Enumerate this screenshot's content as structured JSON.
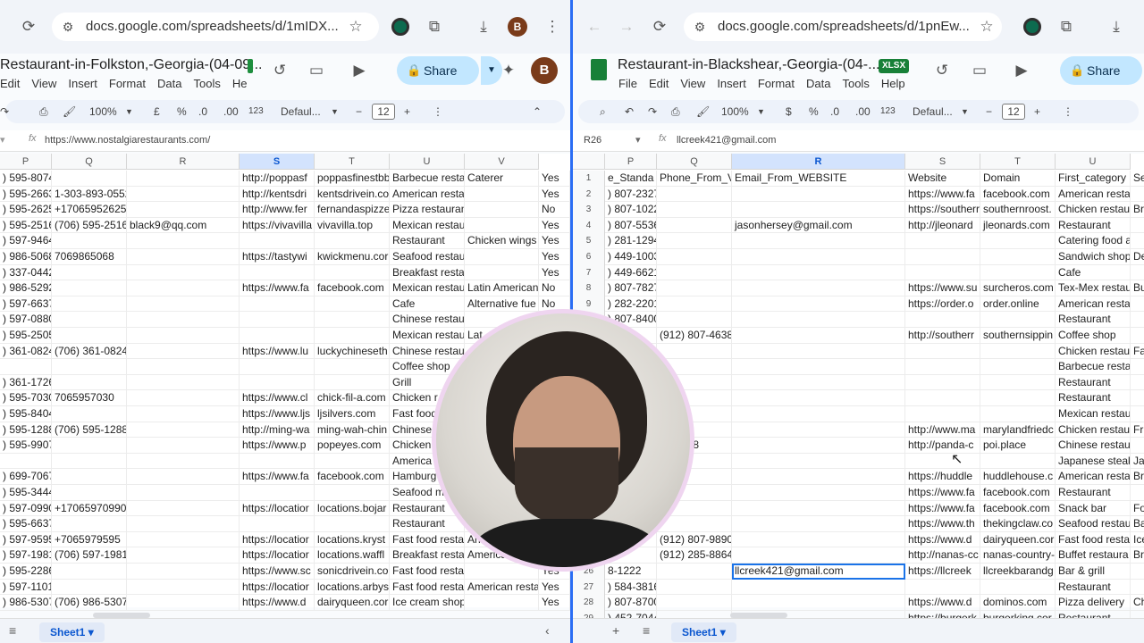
{
  "left": {
    "url": "docs.google.com/spreadsheets/d/1mIDX...",
    "doc_title": "Restaurant-in-Folkston,-Georgia-(04-09...",
    "menu": [
      "Edit",
      "View",
      "Insert",
      "Format",
      "Data",
      "Tools",
      "He"
    ],
    "avatar": "B",
    "share": "Share",
    "zoom": "100%",
    "currency": "£",
    "percent": "%",
    "dec_dec": ".0",
    "dec_inc": ".00",
    "num_fmt": "123",
    "font": "Defaul...",
    "font_size": "12",
    "formula": "https://www.nostalgiarestaurants.com/",
    "columns": [
      "P",
      "Q",
      "R",
      "S",
      "T",
      "U",
      "V"
    ],
    "sheet_tab": "Sheet1",
    "rows": [
      [
        ") 595-8074",
        "",
        "",
        "http://poppasf",
        "poppasfinestbb",
        "Barbecue resta",
        "Caterer",
        "Yes"
      ],
      [
        ") 595-2663",
        "1-303-893-0552",
        "",
        "http://kentsdri",
        "kentsdrivein.co",
        "American resta",
        "",
        "Yes"
      ],
      [
        ") 595-2625",
        "+17065952625 | (706) 595-2625",
        "",
        "http://www.fer",
        "fernandaspizze",
        "Pizza restauran",
        "",
        "No"
      ],
      [
        ") 595-2516",
        "(706) 595-2516",
        "black9@qq.com",
        "https://vivavilla",
        "vivavilla.top",
        "Mexican restau",
        "",
        "Yes"
      ],
      [
        ") 597-9464",
        "",
        "",
        "",
        "",
        "Restaurant",
        "Chicken wings",
        "Yes"
      ],
      [
        ") 986-5068",
        "7069865068",
        "",
        "https://tastywi",
        "kwickmenu.cor",
        "Seafood restau",
        "",
        "Yes"
      ],
      [
        ") 337-0442",
        "",
        "",
        "",
        "",
        "Breakfast resta",
        "",
        "Yes"
      ],
      [
        ") 986-5292",
        "",
        "",
        "https://www.fa",
        "facebook.com",
        "Mexican restau",
        "Latin American",
        "No"
      ],
      [
        ") 597-6637",
        "",
        "",
        "",
        "",
        "Cafe",
        "Alternative fue",
        "No"
      ],
      [
        ") 597-0880",
        "",
        "",
        "",
        "",
        "Chinese restau",
        "",
        ""
      ],
      [
        ") 595-2505",
        "",
        "",
        "",
        "",
        "Mexican restau",
        "Lat",
        ""
      ],
      [
        ") 361-0824",
        "(706) 361-0824",
        "",
        "https://www.lu",
        "luckychineseth",
        "Chinese restau",
        "",
        ""
      ],
      [
        "",
        "",
        "",
        "",
        "",
        "Coffee shop",
        "",
        ""
      ],
      [
        ") 361-1726",
        "",
        "",
        "",
        "",
        "Grill",
        "",
        ""
      ],
      [
        ") 595-7030",
        "7065957030",
        "",
        "https://www.cl",
        "chick-fil-a.com",
        "Chicken r",
        "",
        ""
      ],
      [
        ") 595-8404",
        "",
        "",
        "https://www.ljs",
        "ljsilvers.com",
        "Fast food",
        "",
        ""
      ],
      [
        ") 595-1288",
        "(706) 595-1288",
        "",
        "http://ming-wa",
        "ming-wah-chin",
        "Chinese",
        "",
        ""
      ],
      [
        ") 595-9907",
        "",
        "",
        "https://www.p",
        "popeyes.com",
        "Chicken",
        "",
        ""
      ],
      [
        "",
        "",
        "",
        "",
        "",
        "America",
        "",
        ""
      ],
      [
        ") 699-7067",
        "",
        "",
        "https://www.fa",
        "facebook.com",
        "Hamburg",
        "",
        ""
      ],
      [
        ") 595-3444",
        "",
        "",
        "",
        "",
        "Seafood m",
        "",
        ""
      ],
      [
        ") 597-0990",
        "+17065970990",
        "",
        "https://locatior",
        "locations.bojar",
        "Restaurant",
        "",
        ""
      ],
      [
        ") 595-6637",
        "",
        "",
        "",
        "",
        "Restaurant",
        "",
        ""
      ],
      [
        ") 597-9595",
        "+7065979595",
        "",
        "https://locatior",
        "locations.kryst",
        "Fast food resta",
        "An",
        ""
      ],
      [
        ") 597-1981",
        "(706) 597-1981",
        "",
        "https://locatior",
        "locations.waffl",
        "Breakfast resta",
        "America",
        ""
      ],
      [
        ") 595-2286",
        "",
        "",
        "https://www.sc",
        "sonicdrivein.co",
        "Fast food resta",
        "",
        "Yes"
      ],
      [
        ") 597-1101",
        "",
        "",
        "https://locatior",
        "locations.arbys",
        "Fast food resta",
        "American resta",
        "Yes"
      ],
      [
        ") 986-5307",
        "(706) 986-5307",
        "",
        "https://www.d",
        "dairyqueen.cor",
        "Ice cream shop",
        "",
        "Yes"
      ]
    ]
  },
  "right": {
    "url": "docs.google.com/spreadsheets/d/1pnEw...",
    "doc_title": "Restaurant-in-Blackshear,-Georgia-(04-...",
    "badge": "XLSX",
    "menu": [
      "File",
      "Edit",
      "View",
      "Insert",
      "Format",
      "Data",
      "Tools",
      "Help"
    ],
    "share": "Share",
    "zoom": "100%",
    "currency": "$",
    "percent": "%",
    "dec_dec": ".0",
    "dec_inc": ".00",
    "num_fmt": "123",
    "font": "Defaul...",
    "font_size": "12",
    "name_box": "R26",
    "formula": "llcreek421@gmail.com",
    "columns": [
      "P",
      "Q",
      "R",
      "S",
      "T",
      "U"
    ],
    "sheet_tab": "Sheet1",
    "row_numbers": [
      "1",
      "2",
      "3",
      "4",
      "5",
      "6",
      "7",
      "8",
      "9",
      "10",
      "11",
      "12",
      "13",
      "14",
      "15",
      "16",
      "17",
      "18",
      "19",
      "20",
      "21",
      "22",
      "23",
      "24",
      "25",
      "26",
      "27",
      "28",
      "29"
    ],
    "rows": [
      [
        "e_Standa",
        "Phone_From_V",
        "Email_From_WEBSITE",
        "Website",
        "Domain",
        "First_category",
        "Se"
      ],
      [
        ") 807-2327",
        "",
        "",
        "https://www.fa",
        "facebook.com",
        "American resta",
        ""
      ],
      [
        ") 807-1022",
        "",
        "",
        "https://southerr",
        "southernroost.",
        "Chicken restau",
        "Bre"
      ],
      [
        ") 807-5536",
        "",
        "jasonhersey@gmail.com",
        "http://jleonard",
        "jleonards.com",
        "Restaurant",
        ""
      ],
      [
        ") 281-1294",
        "",
        "",
        "",
        "",
        "Catering food a",
        ""
      ],
      [
        ") 449-1003",
        "",
        "",
        "",
        "",
        "Sandwich shop",
        "De"
      ],
      [
        ") 449-6621",
        "",
        "",
        "",
        "",
        "Cafe",
        ""
      ],
      [
        ") 807-7827",
        "",
        "",
        "https://www.su",
        "surcheros.com",
        "Tex-Mex restau",
        "Bu"
      ],
      [
        ") 282-2201",
        "",
        "",
        "https://order.o",
        "order.online",
        "American resta",
        ""
      ],
      [
        ") 807-8400",
        "",
        "",
        "",
        "",
        "Restaurant",
        ""
      ],
      [
        "-4638",
        "(912) 807-4638",
        "",
        "http://southerr",
        "southernsippin",
        "Coffee shop",
        ""
      ],
      [
        "",
        "",
        "",
        "",
        "",
        "Chicken restau",
        "Fa"
      ],
      [
        "",
        "",
        "",
        "",
        "",
        "Barbecue resta",
        ""
      ],
      [
        "",
        "",
        "",
        "",
        "",
        "Restaurant",
        ""
      ],
      [
        "",
        "",
        "",
        "",
        "",
        "Restaurant",
        ""
      ],
      [
        "",
        "",
        "",
        "",
        "",
        "Mexican restau",
        ""
      ],
      [
        "",
        "",
        "",
        "http://www.ma",
        "marylandfriedc",
        "Chicken restau",
        "Fr"
      ],
      [
        "",
        "49-3888",
        "",
        "http://panda-c",
        "poi.place",
        "Chinese restau",
        ""
      ],
      [
        "",
        "",
        "",
        "",
        "",
        "Japanese steak",
        "Jap"
      ],
      [
        "",
        "",
        "",
        "https://huddle",
        "huddlehouse.c",
        "American resta",
        "Bre"
      ],
      [
        "",
        "",
        "",
        "https://www.fa",
        "facebook.com",
        "Restaurant",
        ""
      ],
      [
        "",
        "",
        "",
        "https://www.fa",
        "facebook.com",
        "Snack bar",
        "Fo"
      ],
      [
        "",
        "",
        "",
        "https://www.th",
        "thekingclaw.co",
        "Seafood restau",
        "Ba"
      ],
      [
        "",
        "(912) 807-9890",
        "",
        "https://www.d",
        "dairyqueen.cor",
        "Fast food resta",
        "Ice"
      ],
      [
        "-4",
        "(912) 285-8864",
        "",
        "http://nanas-cc",
        "nanas-country-",
        "Buffet restaura",
        "Bre"
      ],
      [
        "8-1222",
        "",
        "llcreek421@gmail.com",
        "https://llcreek",
        "llcreekbarandg",
        "Bar & grill",
        ""
      ],
      [
        ") 584-3816",
        "",
        "",
        "",
        "",
        "Restaurant",
        ""
      ],
      [
        ") 807-8700",
        "",
        "",
        "https://www.d",
        "dominos.com",
        "Pizza delivery",
        "Ch"
      ],
      [
        ") 452-7044",
        "",
        "",
        "https://burgerk",
        "burgerking.cor",
        "Restaurant",
        ""
      ]
    ]
  }
}
